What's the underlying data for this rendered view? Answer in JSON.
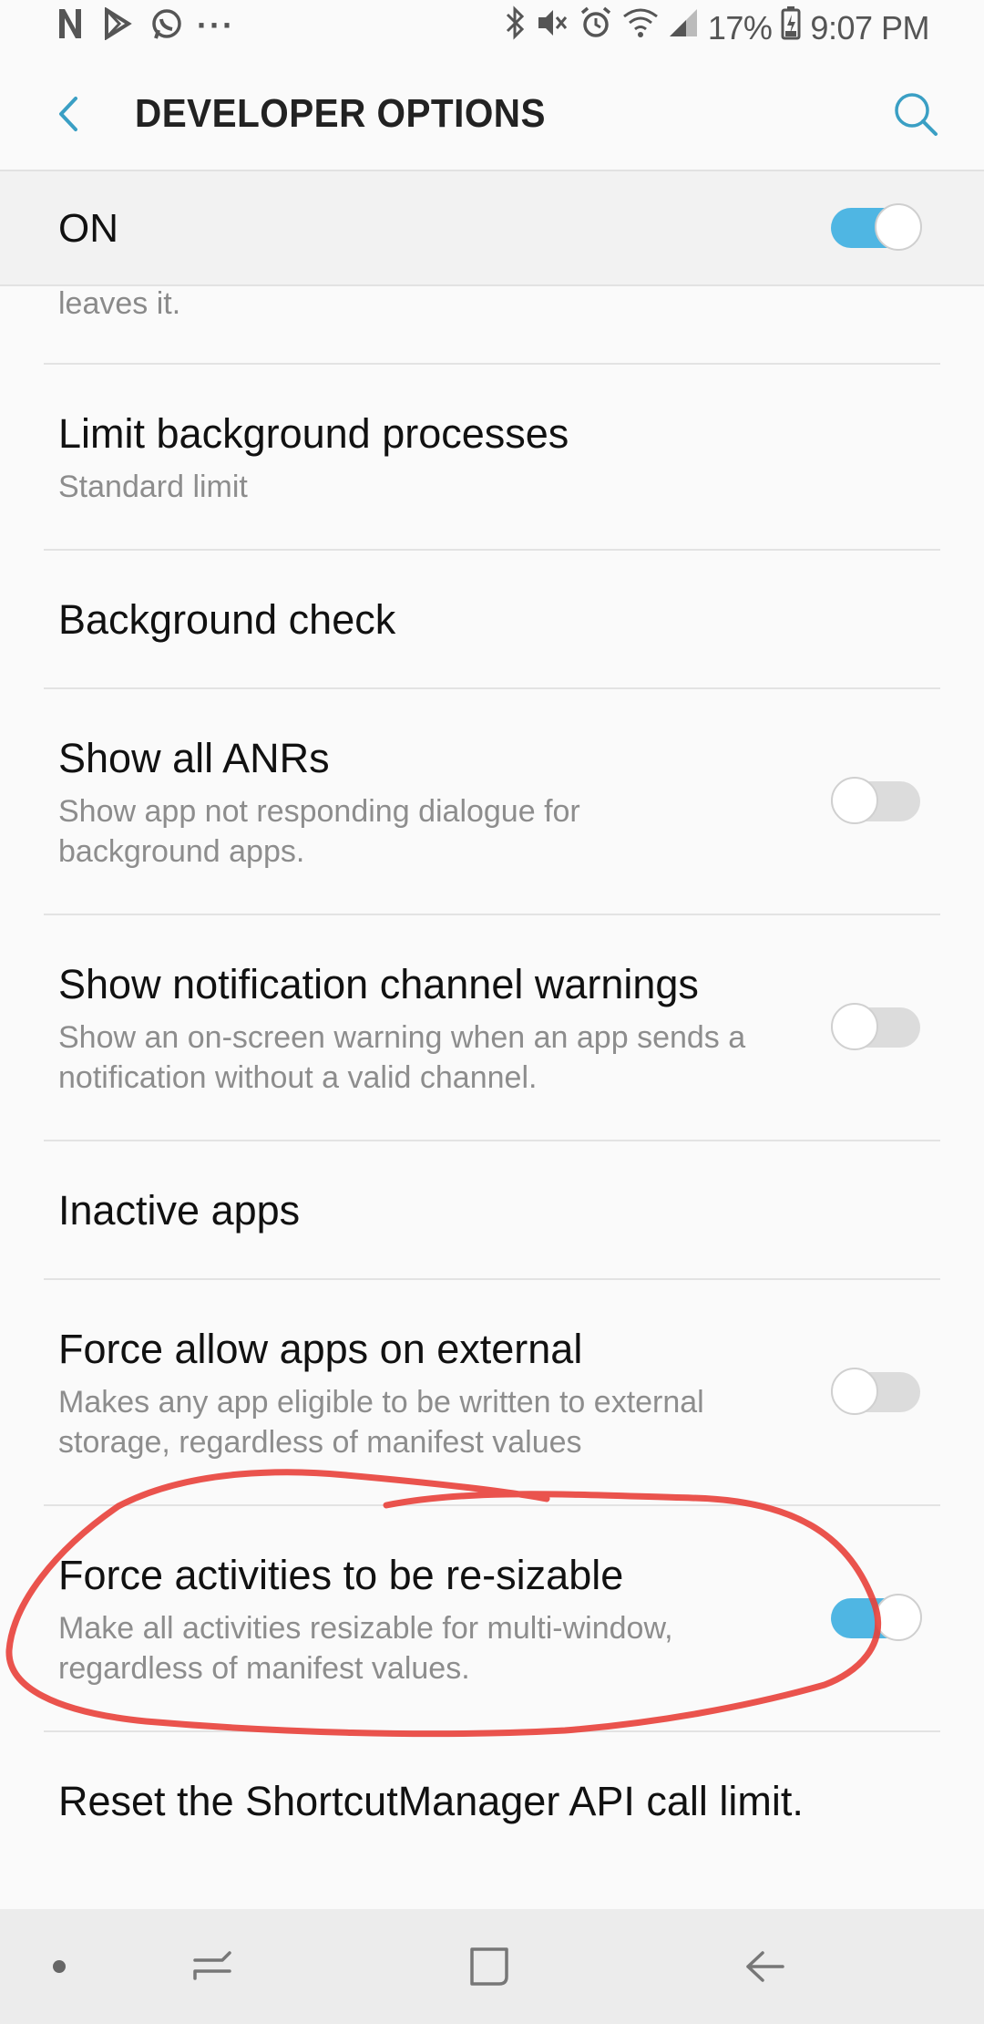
{
  "status_bar": {
    "notification_icons": [
      "n-icon",
      "play-store-icon",
      "whatsapp-icon",
      "more-icon"
    ],
    "more_glyph": "···",
    "battery": "17%",
    "time": "9:07 PM"
  },
  "header": {
    "title": "DEVELOPER OPTIONS"
  },
  "master": {
    "label": "ON",
    "state": "on"
  },
  "list": {
    "partial_text": "leaves it.",
    "items": [
      {
        "title": "Limit background processes",
        "subtitle": "Standard limit"
      },
      {
        "title": "Background check"
      },
      {
        "title": "Show all ANRs",
        "subtitle": "Show app not responding dialogue for background apps.",
        "toggle": "off"
      },
      {
        "title": "Show notification channel warnings",
        "subtitle": "Show an on-screen warning when an app sends a notification without a valid channel.",
        "toggle": "off"
      },
      {
        "title": "Inactive apps"
      },
      {
        "title": "Force allow apps on external",
        "subtitle": "Makes any app eligible to be written to external storage, regardless of manifest values",
        "toggle": "off"
      },
      {
        "title": "Force activities to be re-sizable",
        "subtitle": "Make all activities resizable for multi-window, regardless of manifest values.",
        "toggle": "on"
      },
      {
        "title": "Reset the ShortcutManager API call limit."
      }
    ]
  },
  "colors": {
    "accent": "#4fb6e3",
    "annotation": "#e8403a"
  }
}
